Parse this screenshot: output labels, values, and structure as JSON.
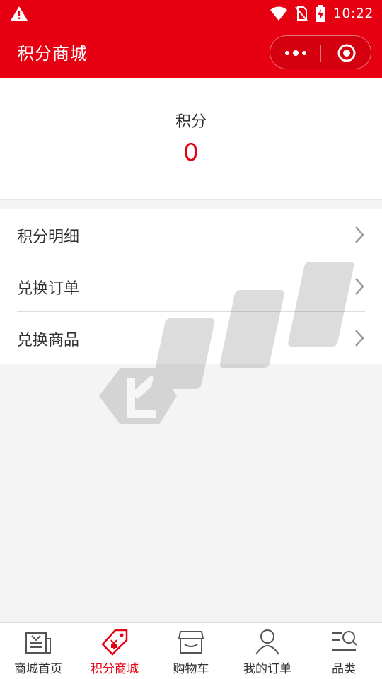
{
  "status_bar": {
    "time": "10:22"
  },
  "nav": {
    "title": "积分商城"
  },
  "points": {
    "label": "积分",
    "value": "0"
  },
  "menu": [
    {
      "label": "积分明细"
    },
    {
      "label": "兑换订单"
    },
    {
      "label": "兑换商品"
    }
  ],
  "tabs": [
    {
      "label": "商城首页",
      "icon": "store-home-icon",
      "active": false
    },
    {
      "label": "积分商城",
      "icon": "yen-tag-icon",
      "active": true
    },
    {
      "label": "购物车",
      "icon": "shop-basket-icon",
      "active": false
    },
    {
      "label": "我的订单",
      "icon": "user-icon",
      "active": false
    },
    {
      "label": "品类",
      "icon": "category-search-icon",
      "active": false
    }
  ],
  "colors": {
    "accent": "#e60012",
    "background": "#f4f4f4",
    "text": "#333333"
  }
}
